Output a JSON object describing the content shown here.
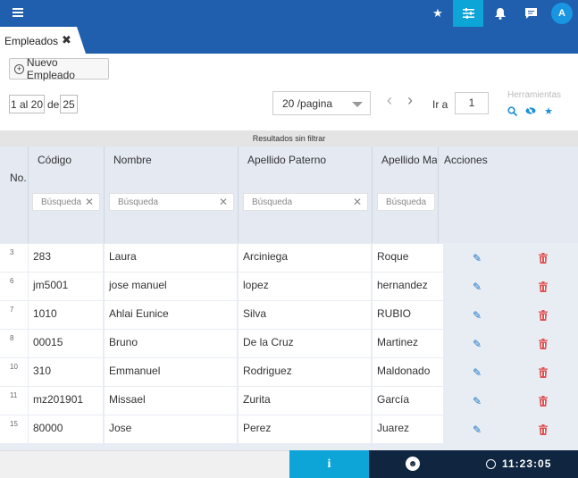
{
  "topbar": {
    "icons": [
      "menu-icon",
      "star-icon",
      "sliders-icon",
      "bell-icon",
      "chat-icon"
    ],
    "avatar_initial": "A",
    "accent": "#1f5fae",
    "active": "#0da4d8"
  },
  "tab": {
    "label": "Empleados",
    "close": "✖"
  },
  "toolbar": {
    "new_label": "Nuevo Empleado"
  },
  "pager": {
    "range": "1 al 20",
    "of": "de",
    "total": "25",
    "per_page": "20 /pagina",
    "goto_label": "Ir a",
    "goto_value": "1",
    "tools_label": "Herramientas"
  },
  "grid": {
    "status": "Resultados sin filtrar",
    "no_header": "No.",
    "columns": [
      "Código",
      "Nombre",
      "Apellido Paterno",
      "Apellido Ma",
      "Acciones"
    ],
    "filter_placeholder": "Búsqueda",
    "rows": [
      {
        "no": "3",
        "codigo": "283",
        "nombre": "Laura",
        "paterno": "Arciniega",
        "materno": "Roque"
      },
      {
        "no": "6",
        "codigo": "jm5001",
        "nombre": "jose manuel",
        "paterno": "lopez",
        "materno": "hernandez"
      },
      {
        "no": "7",
        "codigo": "1010",
        "nombre": "Ahlai Eunice",
        "paterno": "Silva",
        "materno": "RUBIO"
      },
      {
        "no": "8",
        "codigo": "00015",
        "nombre": "Bruno",
        "paterno": "De la Cruz",
        "materno": "Martinez"
      },
      {
        "no": "10",
        "codigo": "310",
        "nombre": "Emmanuel",
        "paterno": "Rodriguez",
        "materno": "Maldonado"
      },
      {
        "no": "11",
        "codigo": "mz201901",
        "nombre": "Missael",
        "paterno": "Zurita",
        "materno": "García"
      },
      {
        "no": "15",
        "codigo": "80000",
        "nombre": "Jose",
        "paterno": "Perez",
        "materno": "Juarez"
      }
    ]
  },
  "footer": {
    "info": "i",
    "time": "11:23:05"
  }
}
